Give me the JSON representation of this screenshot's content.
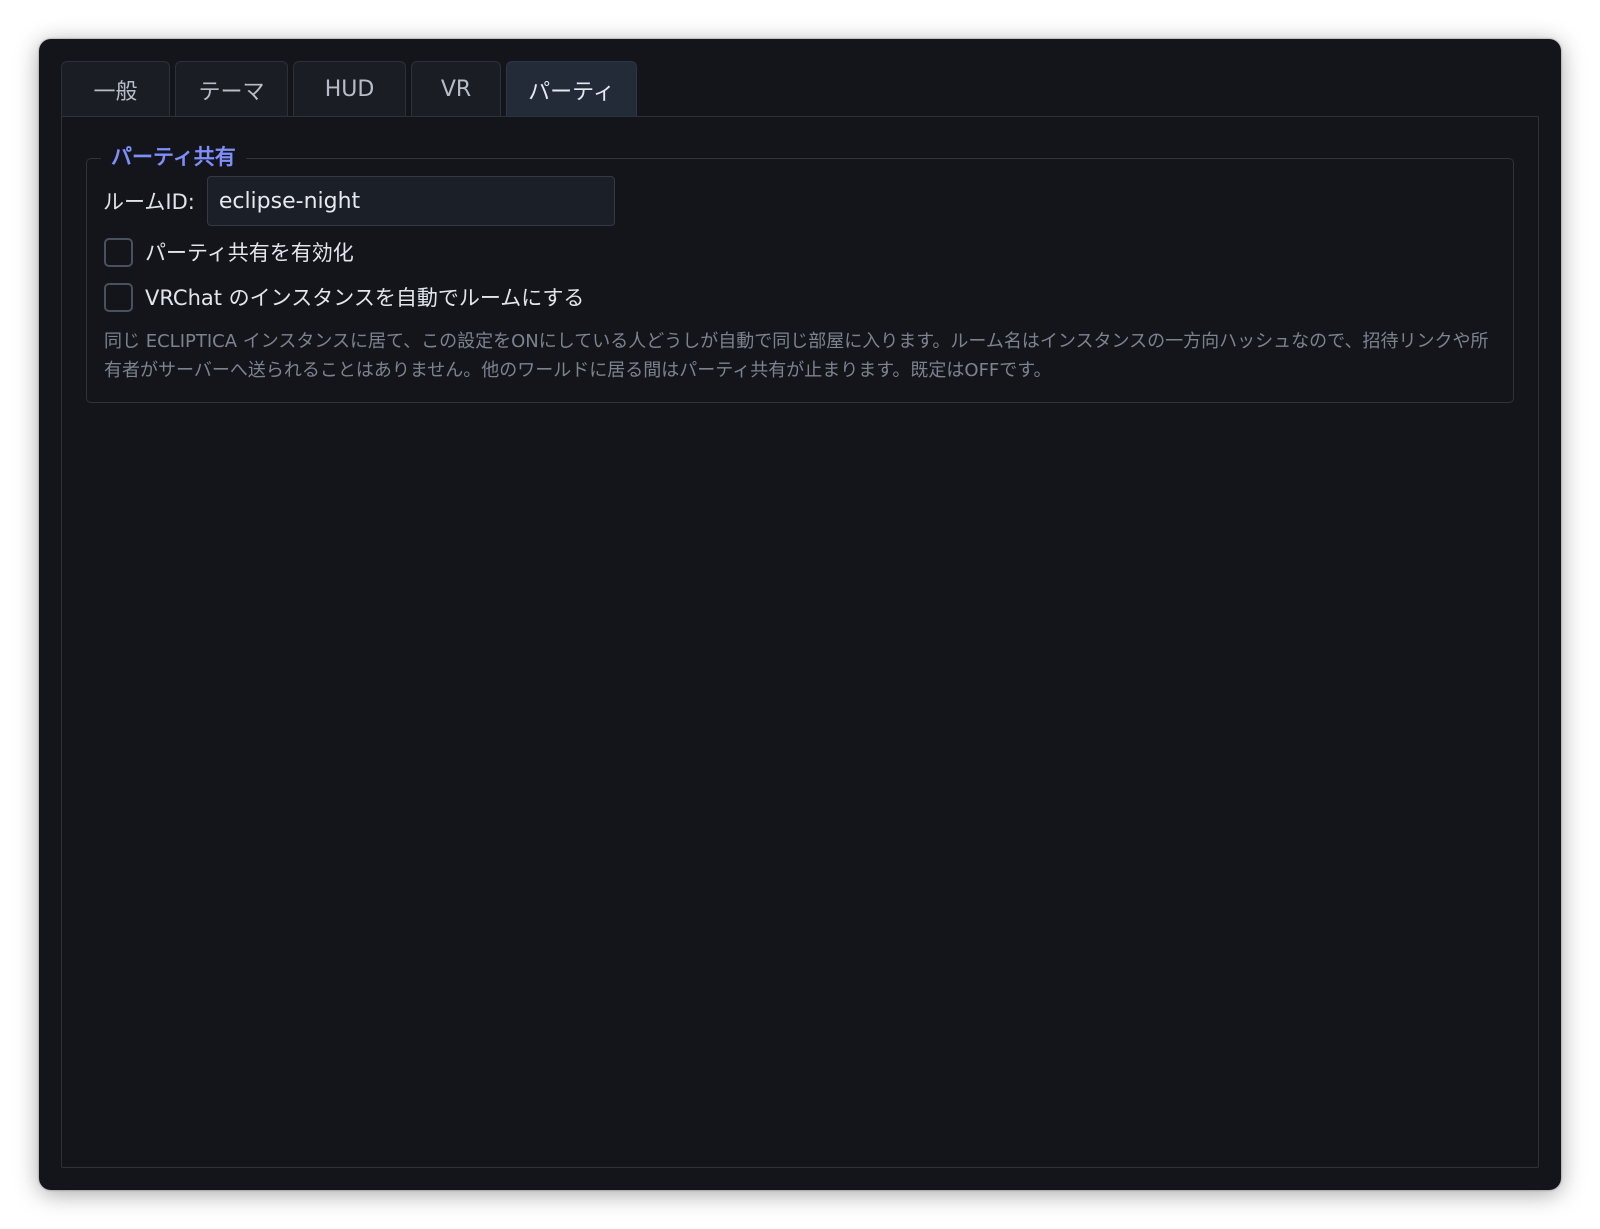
{
  "tabs": [
    {
      "label": "一般",
      "active": false
    },
    {
      "label": "テーマ",
      "active": false
    },
    {
      "label": "HUD",
      "active": false
    },
    {
      "label": "VR",
      "active": false
    },
    {
      "label": "パーティ",
      "active": true
    }
  ],
  "party_group": {
    "title": "パーティ共有",
    "room_id_label": "ルームID:",
    "room_id_value": "eclipse-night",
    "enable_checkbox": {
      "label": "パーティ共有を有効化",
      "checked": false
    },
    "auto_room_checkbox": {
      "label": "VRChat のインスタンスを自動でルームにする",
      "checked": false
    },
    "description": "同じ ECLIPTICA インスタンスに居て、この設定をONにしている人どうしが自動で同じ部屋に入ります。ルーム名はインスタンスの一方向ハッシュなので、招待リンクや所有者がサーバーへ送られることはありません。他のワールドに居る間はパーティ共有が止まります。既定はOFFです。"
  },
  "colors": {
    "window_bg": "#13151b",
    "group_title": "#7f8ffa",
    "active_tab_bg": "#242b38",
    "description_text": "#7c838f"
  }
}
